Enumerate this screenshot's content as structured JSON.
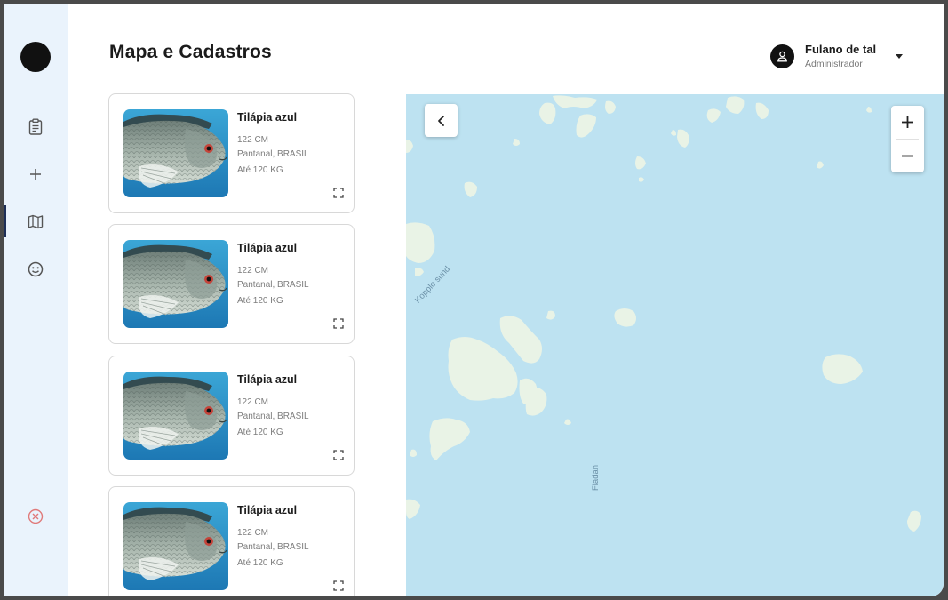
{
  "page": {
    "title": "Mapa e Cadastros"
  },
  "user": {
    "name": "Fulano de tal",
    "role": "Administrador"
  },
  "sidebar": {
    "items": [
      {
        "name": "clipboard-icon"
      },
      {
        "name": "plus-icon"
      },
      {
        "name": "map-icon",
        "active": true
      },
      {
        "name": "smiley-icon"
      },
      {
        "name": "close-circle-icon"
      }
    ]
  },
  "cards": [
    {
      "title": "Tilápia azul",
      "size": "122 CM",
      "location": "Pantanal, BRASIL",
      "weight": "Até 120 KG"
    },
    {
      "title": "Tilápia azul",
      "size": "122 CM",
      "location": "Pantanal, BRASIL",
      "weight": "Até 120 KG"
    },
    {
      "title": "Tilápia azul",
      "size": "122 CM",
      "location": "Pantanal, BRASIL",
      "weight": "Até 120 KG"
    },
    {
      "title": "Tilápia azul",
      "size": "122 CM",
      "location": "Pantanal, BRASIL",
      "weight": "Até 120 KG"
    }
  ],
  "map": {
    "labels": [
      "Kopplo sund",
      "Fladan"
    ],
    "water_color": "#bde2f1",
    "land_color": "#e9f3e6"
  },
  "colors": {
    "sidebar_bg": "#eaf3fc",
    "active_bar": "#1d2e57",
    "close_icon": "#e07a7a"
  }
}
